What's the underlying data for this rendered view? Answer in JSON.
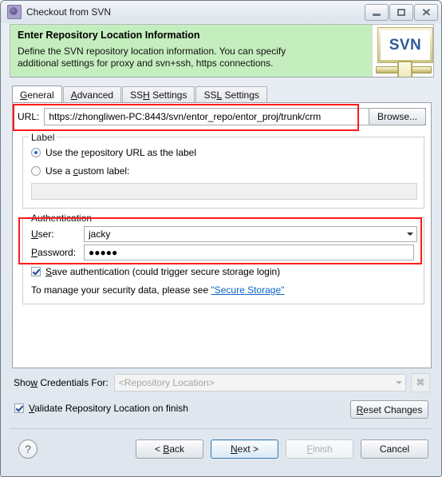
{
  "window": {
    "title": "Checkout from SVN",
    "icon": "svn-gear-icon",
    "minimize_label": "Minimize",
    "restore_label": "Restore",
    "close_label": "Close"
  },
  "banner": {
    "title": "Enter Repository Location Information",
    "description_line1": "Define the SVN repository location information. You can specify",
    "description_line2": "additional settings for proxy and svn+ssh, https connections.",
    "logo_text": "SVN",
    "background_color": "#c5eebe"
  },
  "tabs": [
    {
      "label": "General",
      "mnemonic": "G",
      "selected": true
    },
    {
      "label": "Advanced",
      "mnemonic": "A",
      "selected": false
    },
    {
      "label": "SSH Settings",
      "mnemonic": "H",
      "selected": false
    },
    {
      "label": "SSL Settings",
      "mnemonic": "L",
      "selected": false
    }
  ],
  "url_row": {
    "label": "URL:",
    "value": "https://zhongliwen-PC:8443/svn/entor_repo/entor_proj/trunk/crm",
    "browse_label": "Browse..."
  },
  "label_group": {
    "legend": "Label",
    "option_url": "Use the repository URL as the label",
    "option_url_mnemonic": "r",
    "option_url_selected": true,
    "option_custom": "Use a custom label:",
    "option_custom_mnemonic": "c",
    "option_custom_selected": false,
    "custom_value": "",
    "custom_enabled": false
  },
  "auth_group": {
    "legend": "Authentication",
    "user_label": "User:",
    "user_mnemonic": "U",
    "user_value": "jacky",
    "password_label": "Password:",
    "password_mnemonic": "P",
    "password_value": "●●●●●",
    "save_auth_label": "Save authentication (could trigger secure storage login)",
    "save_auth_mnemonic": "S",
    "save_auth_checked": true,
    "note_prefix": "To manage your security data, please see ",
    "note_link": "\"Secure Storage\""
  },
  "credentials": {
    "label": "Show Credentials For:",
    "label_mnemonic": "w",
    "value": "<Repository Location>",
    "enabled": false,
    "clear_icon": "clear-x-icon"
  },
  "validate": {
    "label": "Validate Repository Location on finish",
    "mnemonic": "V",
    "checked": true,
    "reset_label": "Reset Changes",
    "reset_mnemonic": "R"
  },
  "footer": {
    "help_icon": "help-question-icon",
    "back_label": "< Back",
    "back_mnemonic": "B",
    "next_label": "Next >",
    "next_mnemonic": "N",
    "next_default": true,
    "finish_label": "Finish",
    "finish_mnemonic": "F",
    "finish_enabled": false,
    "cancel_label": "Cancel"
  },
  "annotations": {
    "highlight_color": "#ff1a1a",
    "boxes": [
      "url-field-highlight",
      "authentication-highlight"
    ]
  }
}
